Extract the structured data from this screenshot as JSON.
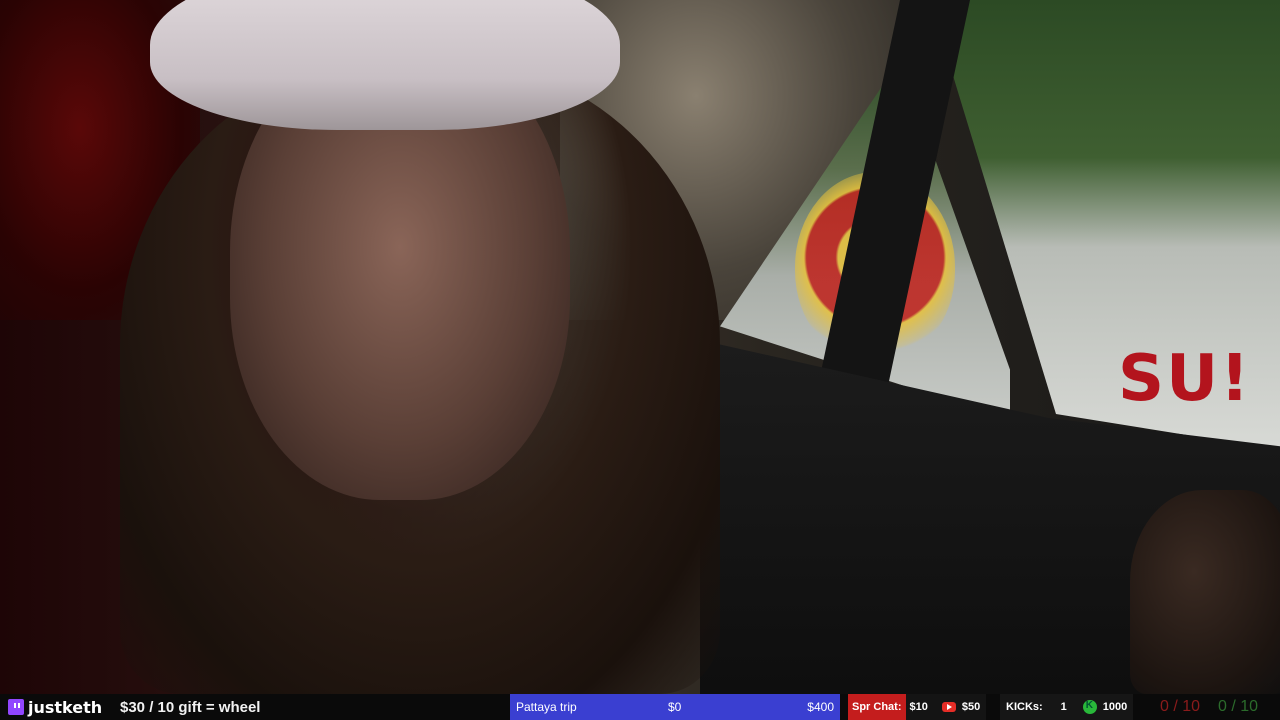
{
  "brand": {
    "name": "justketh",
    "icon": "twitch-icon"
  },
  "promo": "$30 / 10 gift = wheel",
  "goal": {
    "name": "Pattaya trip",
    "current": "$0",
    "target": "$400"
  },
  "spr_chat": {
    "label": "Spr Chat:",
    "amount1": "$10",
    "icon": "youtube-icon",
    "amount2": "$50"
  },
  "kicks": {
    "label": "KICKs:",
    "value1": "1",
    "icon": "kick-icon",
    "value2": "1000"
  },
  "counters": {
    "red": "0 / 10",
    "green": "0 / 10"
  },
  "scene": {
    "banner_text": "SU!"
  },
  "colors": {
    "goal_bar": "#3a3fd1",
    "spr_label": "#c41d1d",
    "twitch": "#9146ff",
    "kick": "#29b83a"
  }
}
